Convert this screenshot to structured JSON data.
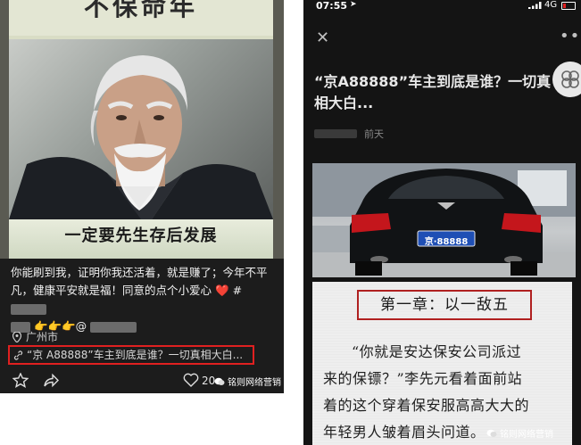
{
  "left_panel": {
    "poster_top_text": "不保命年",
    "poster_caption": "一定要先生存后发展",
    "post_text_line1": "你能刷到我，证明你我还活着，就是赚了；今年不平",
    "post_text_line2": "凡，健康平安就是福！同意的点个小爱心",
    "post_text_hash": "#",
    "post_text_at": "👉👉👉@",
    "location": "广州市",
    "article_link": "“京 A88888”车主到底是谁？一切真相大白...",
    "like_count": "20",
    "watermark": "铭则网络营销"
  },
  "right_panel": {
    "status_time": "07:55",
    "status_network": "4G",
    "article_title": "“京A88888”车主到底是谁？一切真相大白...",
    "meta_time": "前天",
    "license_plate": "京·88888",
    "chapter_heading": "第一章：以一敌五",
    "paragraph_line1": "“你就是安达保安公司派过",
    "paragraph_line2": "来的保镖？”李先元看着面前站",
    "paragraph_line3": "着的这个穿着保安服高高大大的",
    "paragraph_line4": "年轻男人皱着眉头问道。",
    "watermark": "铭则网络营销"
  },
  "icons": {
    "heart": "red-heart-emoji",
    "location": "location-pin-icon",
    "link": "link-icon",
    "star": "star-icon",
    "share": "share-icon",
    "like": "heart-outline-icon",
    "close": "close-icon",
    "more": "more-dots-icon"
  },
  "colors": {
    "highlight_red": "#e02020",
    "chapter_border": "#b02020"
  }
}
